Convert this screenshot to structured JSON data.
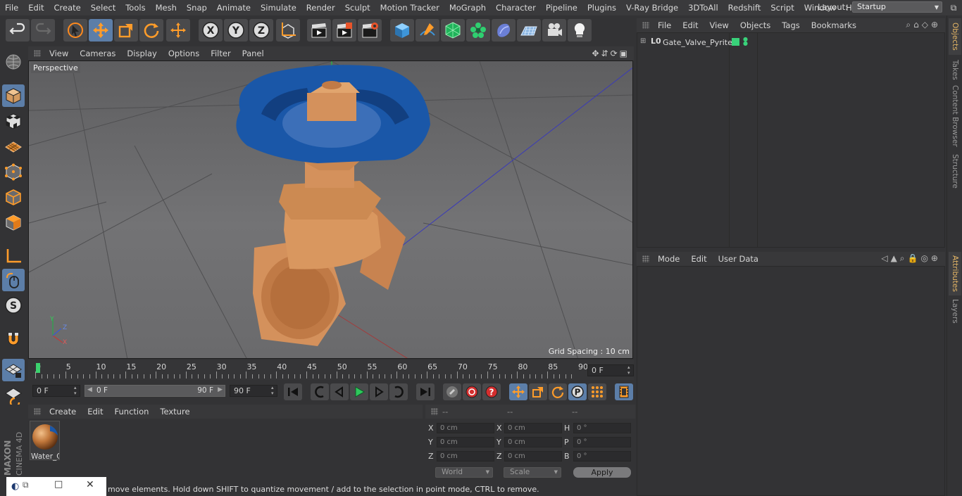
{
  "menubar": {
    "items": [
      "File",
      "Edit",
      "Create",
      "Select",
      "Tools",
      "Mesh",
      "Snap",
      "Animate",
      "Simulate",
      "Render",
      "Sculpt",
      "Motion Tracker",
      "MoGraph",
      "Character",
      "Pipeline",
      "Plugins",
      "V-Ray Bridge",
      "3DToAll",
      "Redshift",
      "Script",
      "Window",
      "Help"
    ],
    "layout_label": "Layout:",
    "layout_value": "Startup"
  },
  "viewport": {
    "menu": [
      "View",
      "Cameras",
      "Display",
      "Options",
      "Filter",
      "Panel"
    ],
    "label": "Perspective",
    "grid_spacing": "Grid Spacing : 10 cm",
    "axes": {
      "x": "X",
      "y": "Y",
      "z": "Z"
    }
  },
  "timeline": {
    "ticks": [
      "0",
      "5",
      "10",
      "15",
      "20",
      "25",
      "30",
      "35",
      "40",
      "45",
      "50",
      "55",
      "60",
      "65",
      "70",
      "75",
      "80",
      "85",
      "90"
    ],
    "current_frame": "0 F"
  },
  "transport": {
    "start_field": "0 F",
    "range_start": "0 F",
    "range_end": "90 F",
    "end_field": "90 F"
  },
  "material_manager": {
    "menu": [
      "Create",
      "Edit",
      "Function",
      "Texture"
    ],
    "materials": [
      {
        "name": "Water_C"
      }
    ]
  },
  "coordinates": {
    "headers": [
      "--",
      "--",
      "--"
    ],
    "rows": [
      {
        "l1": "X",
        "v1": "0 cm",
        "l2": "X",
        "v2": "0 cm",
        "l3": "H",
        "v3": "0 °"
      },
      {
        "l1": "Y",
        "v1": "0 cm",
        "l2": "Y",
        "v2": "0 cm",
        "l3": "P",
        "v3": "0 °"
      },
      {
        "l1": "Z",
        "v1": "0 cm",
        "l2": "Z",
        "v2": "0 cm",
        "l3": "B",
        "v3": "0 °"
      }
    ],
    "world": "World",
    "scale": "Scale",
    "apply": "Apply"
  },
  "status": {
    "text": "move elements. Hold down SHIFT to quantize movement / add to the selection in point mode, CTRL to remove."
  },
  "object_manager": {
    "menu": [
      "File",
      "Edit",
      "View",
      "Objects",
      "Tags",
      "Bookmarks"
    ],
    "objects": [
      {
        "name": "Gate_Valve_Pyrite",
        "tag_color": "#39d27a"
      }
    ]
  },
  "attributes": {
    "menu": [
      "Mode",
      "Edit",
      "User Data"
    ]
  },
  "sidetabs": [
    "Objects",
    "Takes",
    "Content Browser",
    "Structure",
    "Attributes",
    "Layers"
  ],
  "brand": {
    "line1": "MAXON",
    "line2": "CINEMA 4D"
  },
  "colors": {
    "accent": "#5c7ea8",
    "tab_active": "#e6b766",
    "valve_body": "#d4915c",
    "valve_wheel": "#1a57a8"
  }
}
